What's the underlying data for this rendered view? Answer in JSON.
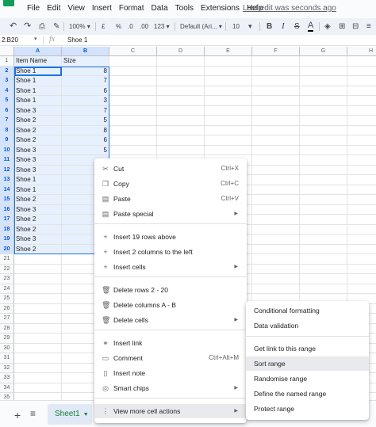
{
  "menubar": {
    "items": [
      "File",
      "Edit",
      "View",
      "Insert",
      "Format",
      "Data",
      "Tools",
      "Extensions",
      "Help"
    ],
    "last_edit": "Last edit was seconds ago"
  },
  "toolbar": {
    "zoom": "100%",
    "currency": "£",
    "percent": "%",
    "decrease_decimals": ".0",
    "increase_decimals": ".00",
    "more_formats": "123",
    "font": "Default (Ari...",
    "font_size": "10",
    "bold": "B",
    "italic": "I",
    "strikethrough": "S",
    "text_color": "A"
  },
  "formula_bar": {
    "name_box": "2:B20",
    "fx": "fx",
    "value": "Shoe  1"
  },
  "columns": [
    "A",
    "B",
    "C",
    "D",
    "E",
    "F",
    "G",
    "H"
  ],
  "rows": [
    {
      "n": "1",
      "a": "Item Name",
      "b": "Size"
    },
    {
      "n": "2",
      "a": "Shoe 1",
      "b": "8"
    },
    {
      "n": "3",
      "a": "Shoe 1",
      "b": "7"
    },
    {
      "n": "4",
      "a": "Shoe 1",
      "b": "6"
    },
    {
      "n": "5",
      "a": "Shoe 1",
      "b": "3"
    },
    {
      "n": "6",
      "a": "Shoe 3",
      "b": "7"
    },
    {
      "n": "7",
      "a": "Shoe 2",
      "b": "5"
    },
    {
      "n": "8",
      "a": "Shoe 2",
      "b": "8"
    },
    {
      "n": "9",
      "a": "Shoe 2",
      "b": "6"
    },
    {
      "n": "10",
      "a": "Shoe 3",
      "b": "5"
    },
    {
      "n": "11",
      "a": "Shoe 3",
      "b": ""
    },
    {
      "n": "12",
      "a": "Shoe 3",
      "b": ""
    },
    {
      "n": "13",
      "a": "Shoe 1",
      "b": ""
    },
    {
      "n": "14",
      "a": "Shoe 1",
      "b": ""
    },
    {
      "n": "15",
      "a": "Shoe 2",
      "b": ""
    },
    {
      "n": "16",
      "a": "Shoe 3",
      "b": ""
    },
    {
      "n": "17",
      "a": "Shoe 2",
      "b": ""
    },
    {
      "n": "18",
      "a": "Shoe 2",
      "b": ""
    },
    {
      "n": "19",
      "a": "Shoe 3",
      "b": ""
    },
    {
      "n": "20",
      "a": "Shoe 2",
      "b": ""
    },
    {
      "n": "21",
      "a": "",
      "b": ""
    },
    {
      "n": "22",
      "a": "",
      "b": ""
    },
    {
      "n": "23",
      "a": "",
      "b": ""
    },
    {
      "n": "24",
      "a": "",
      "b": ""
    },
    {
      "n": "25",
      "a": "",
      "b": ""
    },
    {
      "n": "26",
      "a": "",
      "b": ""
    },
    {
      "n": "27",
      "a": "",
      "b": ""
    },
    {
      "n": "28",
      "a": "",
      "b": ""
    },
    {
      "n": "29",
      "a": "",
      "b": ""
    },
    {
      "n": "30",
      "a": "",
      "b": ""
    },
    {
      "n": "31",
      "a": "",
      "b": ""
    },
    {
      "n": "32",
      "a": "",
      "b": ""
    },
    {
      "n": "33",
      "a": "",
      "b": ""
    },
    {
      "n": "34",
      "a": "",
      "b": ""
    },
    {
      "n": "35",
      "a": "",
      "b": ""
    }
  ],
  "context_menu": {
    "cut": {
      "label": "Cut",
      "shortcut": "Ctrl+X",
      "icon": "scissors-icon"
    },
    "copy": {
      "label": "Copy",
      "shortcut": "Ctrl+C",
      "icon": "copy-icon"
    },
    "paste": {
      "label": "Paste",
      "shortcut": "Ctrl+V",
      "icon": "clipboard-icon"
    },
    "paste_special": {
      "label": "Paste special",
      "icon": "clipboard-icon"
    },
    "insert_rows": {
      "label": "Insert 19 rows above",
      "icon": "plus-icon"
    },
    "insert_cols": {
      "label": "Insert 2 columns to the left",
      "icon": "plus-icon"
    },
    "insert_cells": {
      "label": "Insert cells",
      "icon": "plus-icon"
    },
    "delete_rows": {
      "label": "Delete rows 2 - 20",
      "icon": "trash-icon"
    },
    "delete_cols": {
      "label": "Delete columns A - B",
      "icon": "trash-icon"
    },
    "delete_cells": {
      "label": "Delete cells",
      "icon": "trash-icon"
    },
    "insert_link": {
      "label": "Insert link",
      "icon": "link-icon"
    },
    "comment": {
      "label": "Comment",
      "shortcut": "Ctrl+Alt+M",
      "icon": "comment-icon"
    },
    "insert_note": {
      "label": "Insert note",
      "icon": "note-icon"
    },
    "smart_chips": {
      "label": "Smart chips",
      "icon": "chip-icon"
    },
    "more_actions": {
      "label": "View more cell actions",
      "icon": "more-vert-icon"
    }
  },
  "submenu": {
    "items": [
      "Conditional formatting",
      "Data validation",
      "Get link to this range",
      "Sort range",
      "Randomise range",
      "Define the named range",
      "Protect range"
    ]
  },
  "sheets": {
    "active": "Sheet1",
    "add_icon": "plus-icon",
    "list_icon": "menu-icon"
  },
  "colors": {
    "selection_fill": "#e7f0fd",
    "selection_border": "#1a73e8",
    "sheet_tab_text": "#188038"
  }
}
